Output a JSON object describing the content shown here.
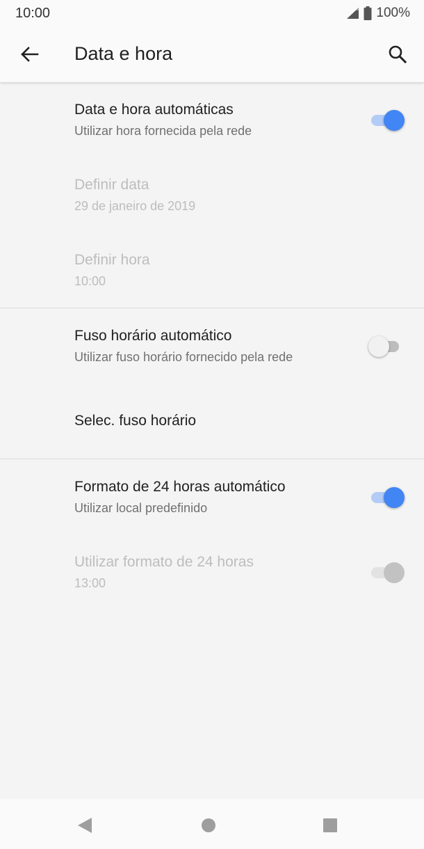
{
  "status_bar": {
    "time": "10:00",
    "battery": "100%"
  },
  "app_bar": {
    "title": "Data e hora"
  },
  "colors": {
    "accent": "#4285f4",
    "text_primary": "#212121",
    "text_secondary": "#707070",
    "text_disabled": "#bdbdbd"
  },
  "settings": {
    "auto_datetime": {
      "title": "Data e hora automáticas",
      "summary": "Utilizar hora fornecida pela rede",
      "checked": true
    },
    "set_date": {
      "title": "Definir data",
      "summary": "29 de janeiro de 2019"
    },
    "set_time": {
      "title": "Definir hora",
      "summary": "10:00"
    },
    "auto_timezone": {
      "title": "Fuso horário automático",
      "summary": "Utilizar fuso horário fornecido pela rede",
      "checked": false
    },
    "select_timezone": {
      "title": "Selec. fuso horário"
    },
    "auto_24h": {
      "title": "Formato de 24 horas automático",
      "summary": "Utilizar local predefinido",
      "checked": true
    },
    "use_24h": {
      "title": "Utilizar formato de 24 horas",
      "summary": "13:00",
      "checked": true
    }
  },
  "icons": {
    "back": "arrow-left-icon",
    "search": "search-icon",
    "signal": "signal-icon",
    "battery": "battery-icon",
    "nav_back": "triangle-back-icon",
    "nav_home": "circle-home-icon",
    "nav_recent": "square-recent-icon"
  }
}
